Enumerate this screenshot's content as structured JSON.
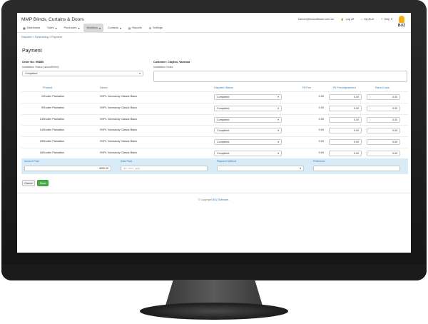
{
  "app": {
    "brand": "MMP Blinds, Curtains & Doors",
    "user_email": "tranner@buzsoftware.com.au",
    "log_off": "Log off",
    "my_buz": "My BUZ",
    "help": "Help",
    "logo_text": "BUZ"
  },
  "nav": [
    {
      "label": "Dashboard",
      "icon": "dashboard-icon",
      "caret": false
    },
    {
      "label": "Sales",
      "icon": "",
      "caret": true
    },
    {
      "label": "Purchases",
      "icon": "",
      "caret": true
    },
    {
      "label": "Workflow",
      "icon": "",
      "caret": true,
      "active": true
    },
    {
      "label": "Contacts",
      "icon": "",
      "caret": true
    },
    {
      "label": "Reports",
      "icon": "reports-icon",
      "caret": false
    },
    {
      "label": "Settings",
      "icon": "settings-icon",
      "caret": false
    }
  ],
  "breadcrumb": {
    "dispatch": "Dispatch",
    "scheduling": "Scheduling",
    "current": "Payment"
  },
  "page_title": "Payment",
  "order": {
    "order_no_label": "Order No: 9938B",
    "installation_status_label": "Installation Status (unconfirmed)",
    "installation_status_value": "Completed",
    "customer_label": "Customer: Clayton, Vanessa",
    "installation_notes_label": "Installation Notes"
  },
  "table": {
    "headers": [
      "Product",
      "Descn",
      "Dispatch Status",
      "Fit Fee",
      "Fit Fee Adjustment",
      "Extra Costs"
    ],
    "rows": [
      {
        "num": "1",
        "product": "Shutter Plantation",
        "descn": "SHPL Normandy Classic Black",
        "status": "Completed",
        "fit_fee": "0.00",
        "adjust": "0.00",
        "extra": "0.00"
      },
      {
        "num": "9",
        "product": "Shutter Plantation",
        "descn": "SHPL Normandy Classic Black",
        "status": "Completed",
        "fit_fee": "0.00",
        "adjust": "0.00",
        "extra": "0.00"
      },
      {
        "num": "13",
        "product": "Shutter Plantation",
        "descn": "SHPL Normandy Classic Black",
        "status": "Completed",
        "fit_fee": "0.00",
        "adjust": "0.00",
        "extra": "0.00"
      },
      {
        "num": "14",
        "product": "Shutter Plantation",
        "descn": "SHPL Normandy Classic Black",
        "status": "Completed",
        "fit_fee": "0.00",
        "adjust": "0.00",
        "extra": "0.00"
      },
      {
        "num": "15",
        "product": "Shutter Plantation",
        "descn": "SHPL Normandy Classic Black",
        "status": "Completed",
        "fit_fee": "0.00",
        "adjust": "0.00",
        "extra": "0.00"
      },
      {
        "num": "16",
        "product": "Shutter Plantation",
        "descn": "SHPL Normandy Classic Black",
        "status": "Completed",
        "fit_fee": "0.00",
        "adjust": "0.00",
        "extra": "0.00"
      }
    ]
  },
  "payment": {
    "amount_label": "Amount Paid",
    "amount_value": "4500.00",
    "date_label": "Date Paid",
    "date_placeholder": "dd / mm / yyyy",
    "method_label": "Payment Method",
    "method_value": "",
    "reference_label": "Reference",
    "reference_value": ""
  },
  "buttons": {
    "cancel": "Cancel",
    "save": "Save"
  },
  "footer": {
    "prefix": "© Copyright",
    "link": "BUZ Software",
    "suffix": "-"
  }
}
